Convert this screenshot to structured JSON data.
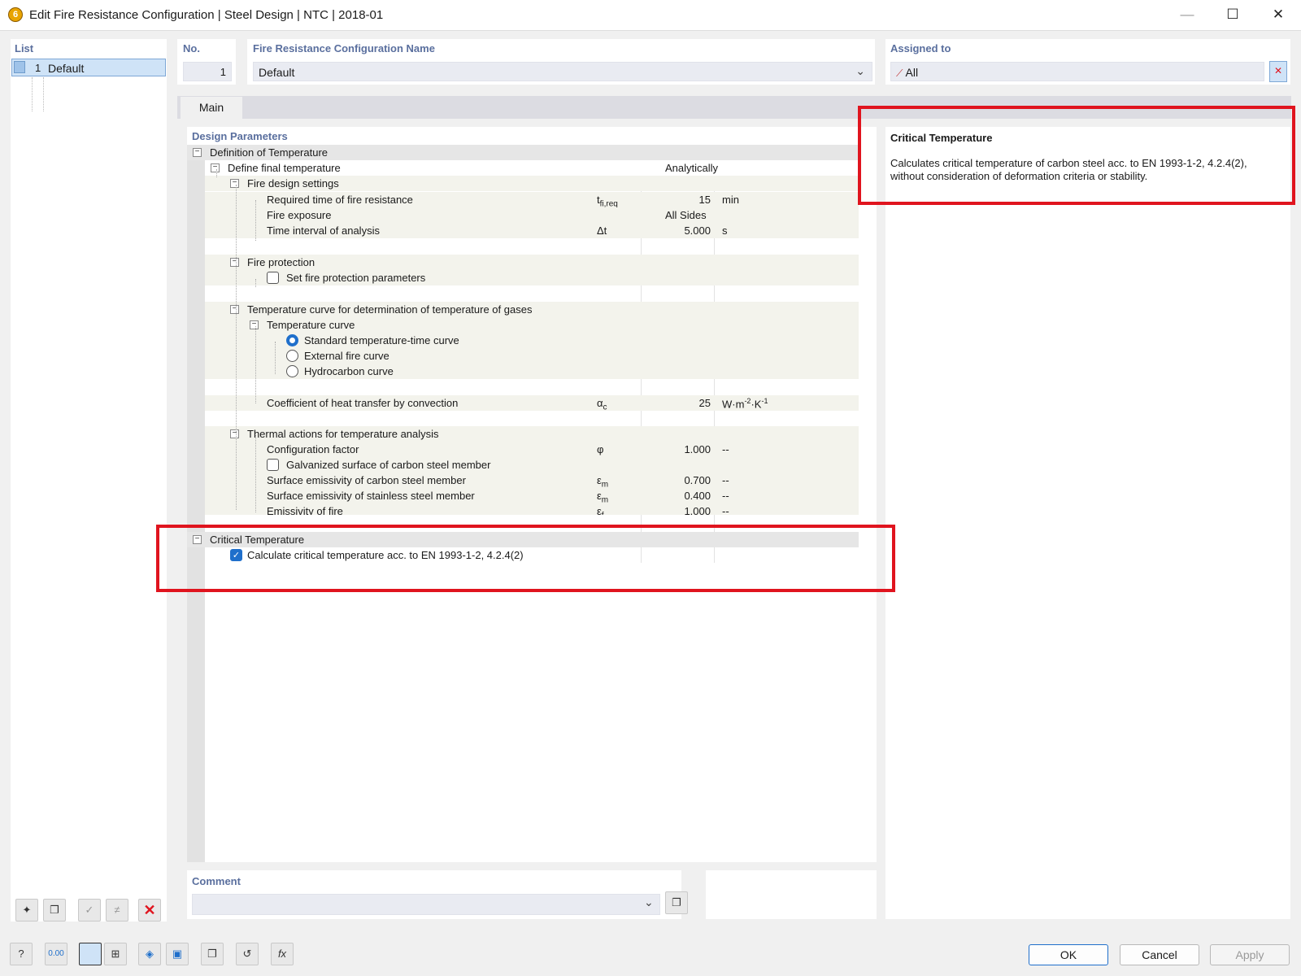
{
  "window": {
    "title": "Edit Fire Resistance Configuration | Steel Design | NTC | 2018-01",
    "app_icon_glyph": "6",
    "minimize_glyph": "—",
    "maximize_glyph": "☐",
    "close_glyph": "✕"
  },
  "list": {
    "label": "List",
    "items": [
      {
        "no": "1",
        "name": "Default"
      }
    ]
  },
  "header": {
    "no_label": "No.",
    "no_value": "1",
    "name_label": "Fire Resistance Configuration Name",
    "name_value": "Default",
    "assigned_label": "Assigned to",
    "assigned_value": "All"
  },
  "tabs": [
    {
      "label": "Main",
      "active": true
    }
  ],
  "design_params_label": "Design Parameters",
  "tree": {
    "definition_of_temperature": "Definition of Temperature",
    "define_final_temperature": "Define final temperature",
    "define_final_temperature_value": "Analytically",
    "fire_design_settings": "Fire design settings",
    "req_time_label": "Required time of fire resistance",
    "req_time_symbol": "t",
    "req_time_sub": "fi,req",
    "req_time_value": "15",
    "req_time_unit": "min",
    "fire_exposure_label": "Fire exposure",
    "fire_exposure_value": "All Sides",
    "time_interval_label": "Time interval of analysis",
    "time_interval_symbol": "Δt",
    "time_interval_value": "5.000",
    "time_interval_unit": "s",
    "fire_protection": "Fire protection",
    "set_fire_protection": "Set fire protection parameters",
    "temp_curve_gases": "Temperature curve for determination of temperature of gases",
    "temp_curve": "Temperature curve",
    "curve_standard": "Standard temperature-time curve",
    "curve_external": "External fire curve",
    "curve_hydrocarbon": "Hydrocarbon curve",
    "coef_heat_label": "Coefficient of heat transfer by convection",
    "coef_heat_symbol": "α",
    "coef_heat_sub": "c",
    "coef_heat_value": "25",
    "coef_heat_unit": "W·m",
    "coef_heat_unit_exp1": "-2",
    "coef_heat_unit_mid": "·K",
    "coef_heat_unit_exp2": "-1",
    "thermal_actions": "Thermal actions for temperature analysis",
    "config_factor_label": "Configuration factor",
    "config_factor_symbol": "φ",
    "config_factor_value": "1.000",
    "config_factor_unit": "--",
    "galvanized_label": "Galvanized surface of carbon steel member",
    "emis_carbon_label": "Surface emissivity of carbon steel member",
    "emis_carbon_symbol": "ε",
    "emis_carbon_sub": "m",
    "emis_carbon_value": "0.700",
    "emis_carbon_unit": "--",
    "emis_stainless_label": "Surface emissivity of stainless steel member",
    "emis_stainless_symbol": "ε",
    "emis_stainless_sub": "m",
    "emis_stainless_value": "0.400",
    "emis_stainless_unit": "--",
    "emis_fire_label": "Emissivity of fire",
    "emis_fire_symbol": "ε",
    "emis_fire_sub": "f",
    "emis_fire_value": "1.000",
    "emis_fire_unit": "--",
    "critical_temperature": "Critical Temperature",
    "calc_critical_label": "Calculate critical temperature acc. to EN 1993-1-2, 4.2.4(2)"
  },
  "info": {
    "title": "Critical Temperature",
    "line1": "Calculates critical temperature of carbon steel acc. to EN 1993-1-2, 4.2.4(2),",
    "line2": "without consideration of deformation criteria or stability."
  },
  "comment": {
    "label": "Comment",
    "value": ""
  },
  "buttons": {
    "ok": "OK",
    "cancel": "Cancel",
    "apply": "Apply"
  },
  "bottom_toolbar_icons": [
    "help-icon",
    "numeric-format-icon",
    "color-swatch-icon",
    "member-view-icon",
    "model-view-icon",
    "save-icon",
    "copy-settings-icon",
    "reset-icon",
    "formula-icon"
  ],
  "list_toolbar_icons": [
    "new-item-icon",
    "copy-item-icon",
    "check-all-icon",
    "uncheck-all-icon",
    "delete-icon"
  ],
  "colors": {
    "accent": "#1f6fcb",
    "highlight_border": "#e0141e",
    "label_blue": "#5a6f9e"
  }
}
